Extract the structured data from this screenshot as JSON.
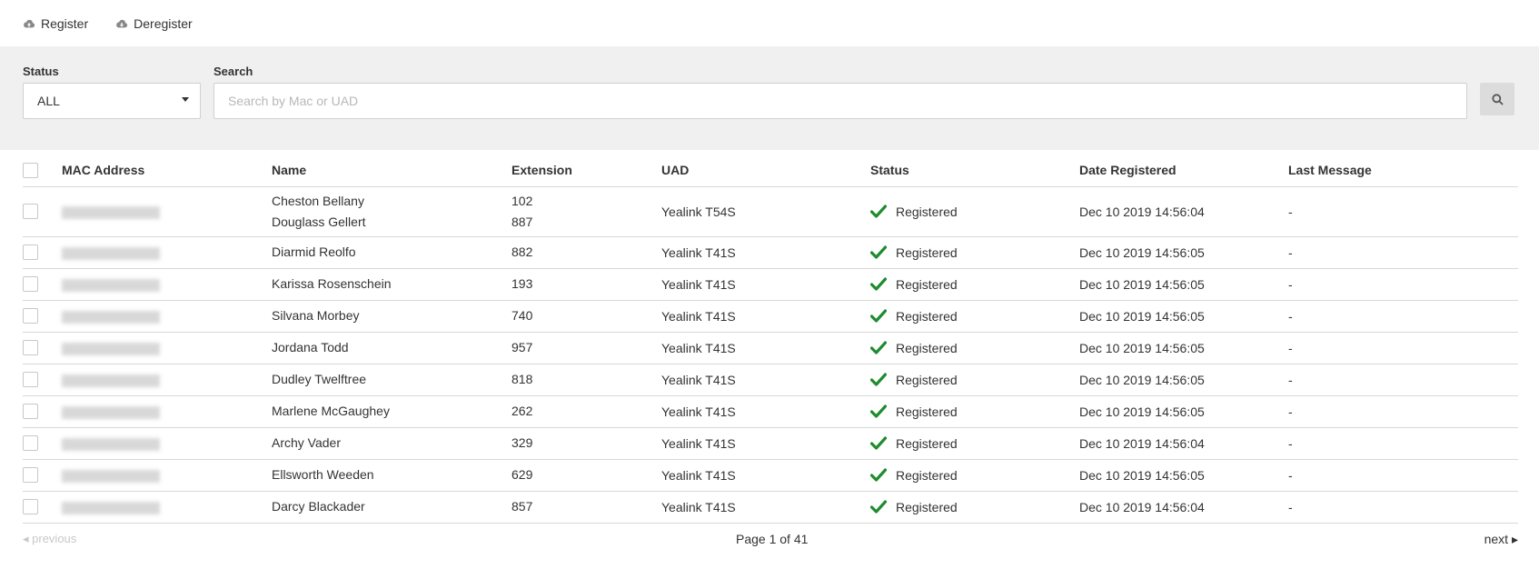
{
  "toolbar": {
    "register_label": "Register",
    "deregister_label": "Deregister"
  },
  "filters": {
    "status_label": "Status",
    "status_value": "ALL",
    "search_label": "Search",
    "search_placeholder": "Search by Mac or UAD"
  },
  "table": {
    "headers": [
      "MAC Address",
      "Name",
      "Extension",
      "UAD",
      "Status",
      "Date Registered",
      "Last Message"
    ],
    "rows": [
      {
        "names": [
          "Cheston Bellany",
          "Douglass Gellert"
        ],
        "extensions": [
          "102",
          "887"
        ],
        "uad": "Yealink T54S",
        "status": "Registered",
        "date": "Dec 10 2019 14:56:04",
        "last": "-"
      },
      {
        "names": [
          "Diarmid Reolfo"
        ],
        "extensions": [
          "882"
        ],
        "uad": "Yealink T41S",
        "status": "Registered",
        "date": "Dec 10 2019 14:56:05",
        "last": "-"
      },
      {
        "names": [
          "Karissa Rosenschein"
        ],
        "extensions": [
          "193"
        ],
        "uad": "Yealink T41S",
        "status": "Registered",
        "date": "Dec 10 2019 14:56:05",
        "last": "-"
      },
      {
        "names": [
          "Silvana Morbey"
        ],
        "extensions": [
          "740"
        ],
        "uad": "Yealink T41S",
        "status": "Registered",
        "date": "Dec 10 2019 14:56:05",
        "last": "-"
      },
      {
        "names": [
          "Jordana Todd"
        ],
        "extensions": [
          "957"
        ],
        "uad": "Yealink T41S",
        "status": "Registered",
        "date": "Dec 10 2019 14:56:05",
        "last": "-"
      },
      {
        "names": [
          "Dudley Twelftree"
        ],
        "extensions": [
          "818"
        ],
        "uad": "Yealink T41S",
        "status": "Registered",
        "date": "Dec 10 2019 14:56:05",
        "last": "-"
      },
      {
        "names": [
          "Marlene McGaughey"
        ],
        "extensions": [
          "262"
        ],
        "uad": "Yealink T41S",
        "status": "Registered",
        "date": "Dec 10 2019 14:56:05",
        "last": "-"
      },
      {
        "names": [
          "Archy Vader"
        ],
        "extensions": [
          "329"
        ],
        "uad": "Yealink T41S",
        "status": "Registered",
        "date": "Dec 10 2019 14:56:04",
        "last": "-"
      },
      {
        "names": [
          "Ellsworth Weeden"
        ],
        "extensions": [
          "629"
        ],
        "uad": "Yealink T41S",
        "status": "Registered",
        "date": "Dec 10 2019 14:56:05",
        "last": "-"
      },
      {
        "names": [
          "Darcy Blackader"
        ],
        "extensions": [
          "857"
        ],
        "uad": "Yealink T41S",
        "status": "Registered",
        "date": "Dec 10 2019 14:56:04",
        "last": "-"
      }
    ]
  },
  "pagination": {
    "previous_label": "previous",
    "page_text": "Page 1 of 41",
    "next_label": "next"
  },
  "colors": {
    "registered_check": "#1e8c2e",
    "filter_panel_bg": "#f0f0f0"
  }
}
